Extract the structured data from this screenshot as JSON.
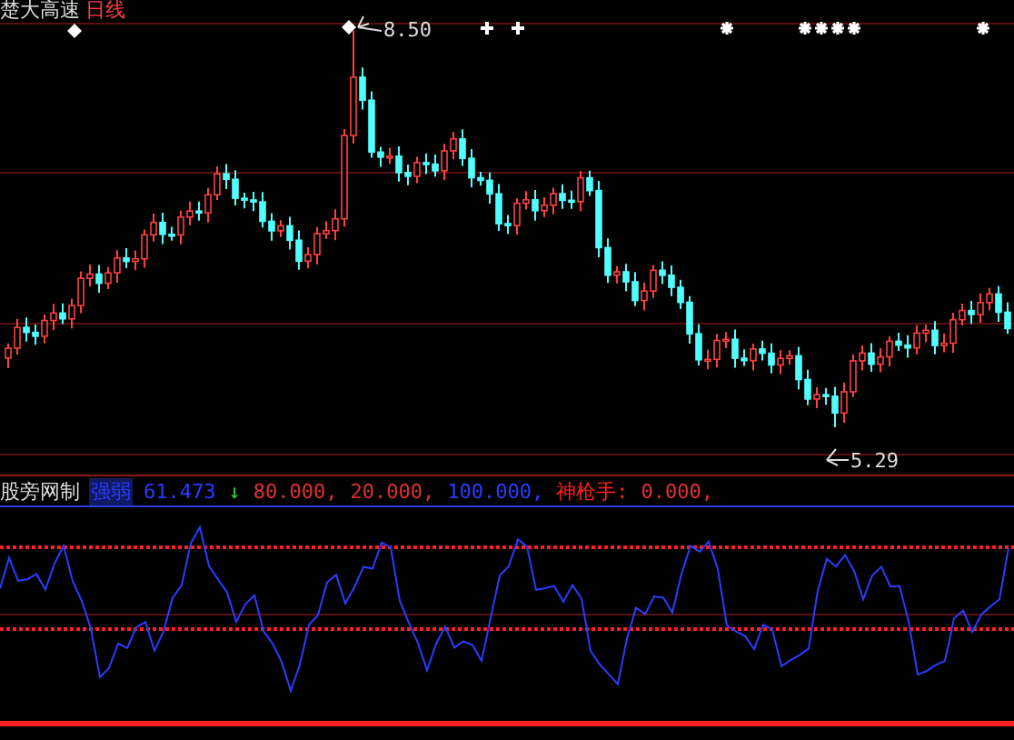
{
  "header": {
    "title": "楚大高速",
    "period": "日线"
  },
  "chart": {
    "high_label": "8.50",
    "low_label": "5.29"
  },
  "indicator": {
    "source": "股旁网制",
    "items": [
      {
        "text": "强弱",
        "kind": "indicator",
        "highlighted": true
      },
      {
        "text": "61.473",
        "kind": "value",
        "highlighted": false
      },
      {
        "text": "↓",
        "kind": "signal",
        "highlighted": false
      },
      {
        "text": "80.000,",
        "kind": "threshold",
        "highlighted": false
      },
      {
        "text": "20.000,",
        "kind": "threshold",
        "highlighted": false
      },
      {
        "text": "100.000,",
        "kind": "value",
        "highlighted": false
      },
      {
        "text": "神枪手:",
        "kind": "name",
        "highlighted": false
      },
      {
        "text": "0.000,",
        "kind": "threshold",
        "highlighted": false
      }
    ]
  }
}
